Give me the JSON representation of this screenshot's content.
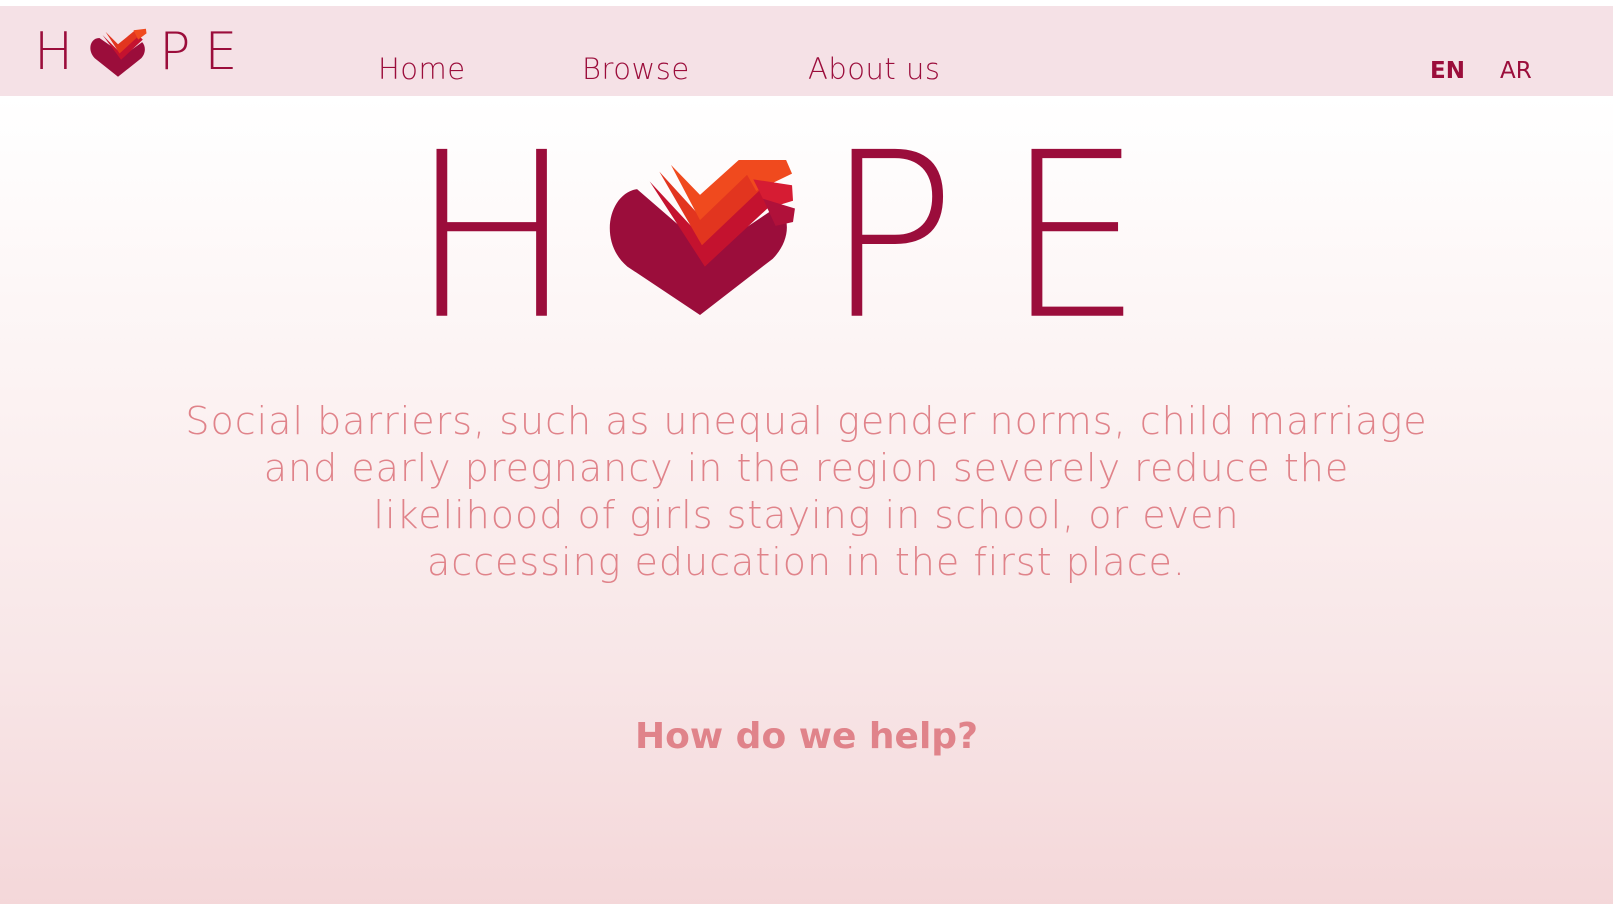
{
  "brand": {
    "name": "HOPE",
    "letters": [
      "H",
      "P",
      "E"
    ],
    "logo_icon": "heart-hands-icon",
    "primary_color": "#9b0d3b",
    "text_color": "#e0838a",
    "nav_bg_color": "#f5e1e6"
  },
  "nav": {
    "links": [
      "Home",
      "Browse",
      "About us"
    ],
    "languages": [
      {
        "code": "EN",
        "active": true
      },
      {
        "code": "AR",
        "active": false
      }
    ]
  },
  "hero": {
    "lines": [
      "Social barriers, such as unequal gender norms, child marriage",
      "and early pregnancy in the region severely reduce the",
      "likelihood of girls staying in school, or even",
      "accessing education in the first place."
    ],
    "cta": "How do we help?"
  }
}
